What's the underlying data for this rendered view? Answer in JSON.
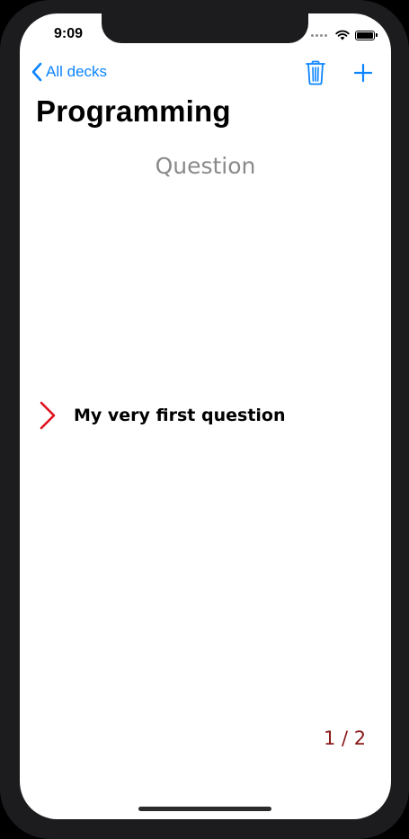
{
  "status_bar": {
    "time": "9:09"
  },
  "nav": {
    "back_label": "All decks",
    "back_icon": "chevron-left-icon",
    "trash_icon": "trash-icon",
    "add_icon": "plus-icon"
  },
  "deck": {
    "title": "Programming"
  },
  "card": {
    "side_label": "Question",
    "text": "My very first question",
    "expand_icon": "chevron-right-icon"
  },
  "pagination": {
    "text": "1 / 2"
  },
  "colors": {
    "accent": "#0a84ff",
    "chevron": "#e0101c",
    "pagination": "#8b1a1a",
    "heading": "#8a8a8a"
  }
}
